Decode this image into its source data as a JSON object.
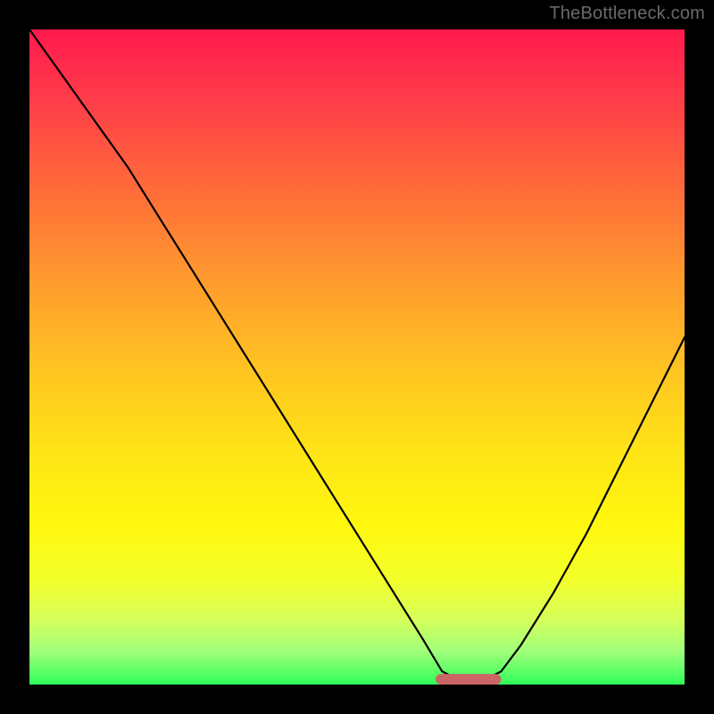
{
  "watermark": "TheBottleneck.com",
  "chart_data": {
    "type": "line",
    "title": "",
    "xlabel": "",
    "ylabel": "",
    "xlim": [
      0,
      100
    ],
    "ylim": [
      0,
      100
    ],
    "grid": false,
    "legend": false,
    "series": [
      {
        "name": "bottleneck-curve",
        "x": [
          0,
          5,
          10,
          15,
          20,
          25,
          30,
          35,
          40,
          45,
          50,
          55,
          60,
          63,
          65,
          68,
          70,
          72,
          75,
          80,
          85,
          90,
          95,
          100
        ],
        "y": [
          100,
          93,
          86,
          79,
          71,
          63,
          55,
          47,
          39,
          31,
          23,
          15,
          7,
          2,
          1,
          1,
          1,
          2,
          6,
          14,
          23,
          33,
          43,
          53
        ]
      }
    ],
    "annotations": [
      {
        "name": "trough-highlight",
        "shape": "pill",
        "x_range": [
          62,
          72
        ],
        "y": 0.8,
        "color": "#cc6666"
      }
    ],
    "background_gradient": {
      "top": "#ff1a4d",
      "bottom": "#2eff5a"
    }
  }
}
